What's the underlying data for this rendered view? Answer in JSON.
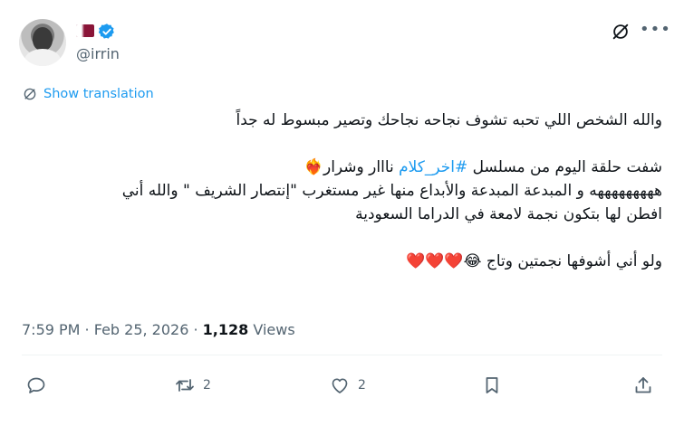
{
  "author": {
    "handle": "@irrin",
    "flag": "Qatar",
    "verified": true
  },
  "icons": {
    "avatar": "profile-photo",
    "flag": "qatar-flag-icon",
    "verified": "verified-badge-icon",
    "grok": "grok-icon",
    "more": "more-icon",
    "translate": "translate-icon",
    "reply": "reply-icon",
    "retweet": "retweet-icon",
    "like": "like-icon",
    "bookmark": "bookmark-icon",
    "share": "share-icon"
  },
  "translate_label": "Show translation",
  "tweet": {
    "line1": "والله الشخص اللي تحبه تشوف نجاحه نجاحك وتصير مبسوط له جداً",
    "line2_prefix": "شفت حلقة اليوم من مسلسل ",
    "line2_hashtag": "#اخر_كلام",
    "line2_suffix": " نااار وشرار❤️‍🔥",
    "line3": "هههههههههه و المبدعة المبدعة والأبداع منها غير مستغرب \"إنتصار الشريف \" والله أني",
    "line4": "افطن لها بتكون نجمة لامعة في الدراما السعودية",
    "line5": "ولو أني أشوفها نجمتين وتاج 😂❤️❤️❤️"
  },
  "meta": {
    "time": "7:59 PM",
    "sep": " · ",
    "date": "Feb 25, 2026",
    "views_count": "1,128",
    "views_label": "Views"
  },
  "actions": {
    "reply_count": "",
    "retweet_count": "2",
    "like_count": "2"
  },
  "colors": {
    "accent": "#1d9bf0",
    "secondary_text": "#536471",
    "primary_text": "#0f1419",
    "flag": "#8a1538"
  }
}
